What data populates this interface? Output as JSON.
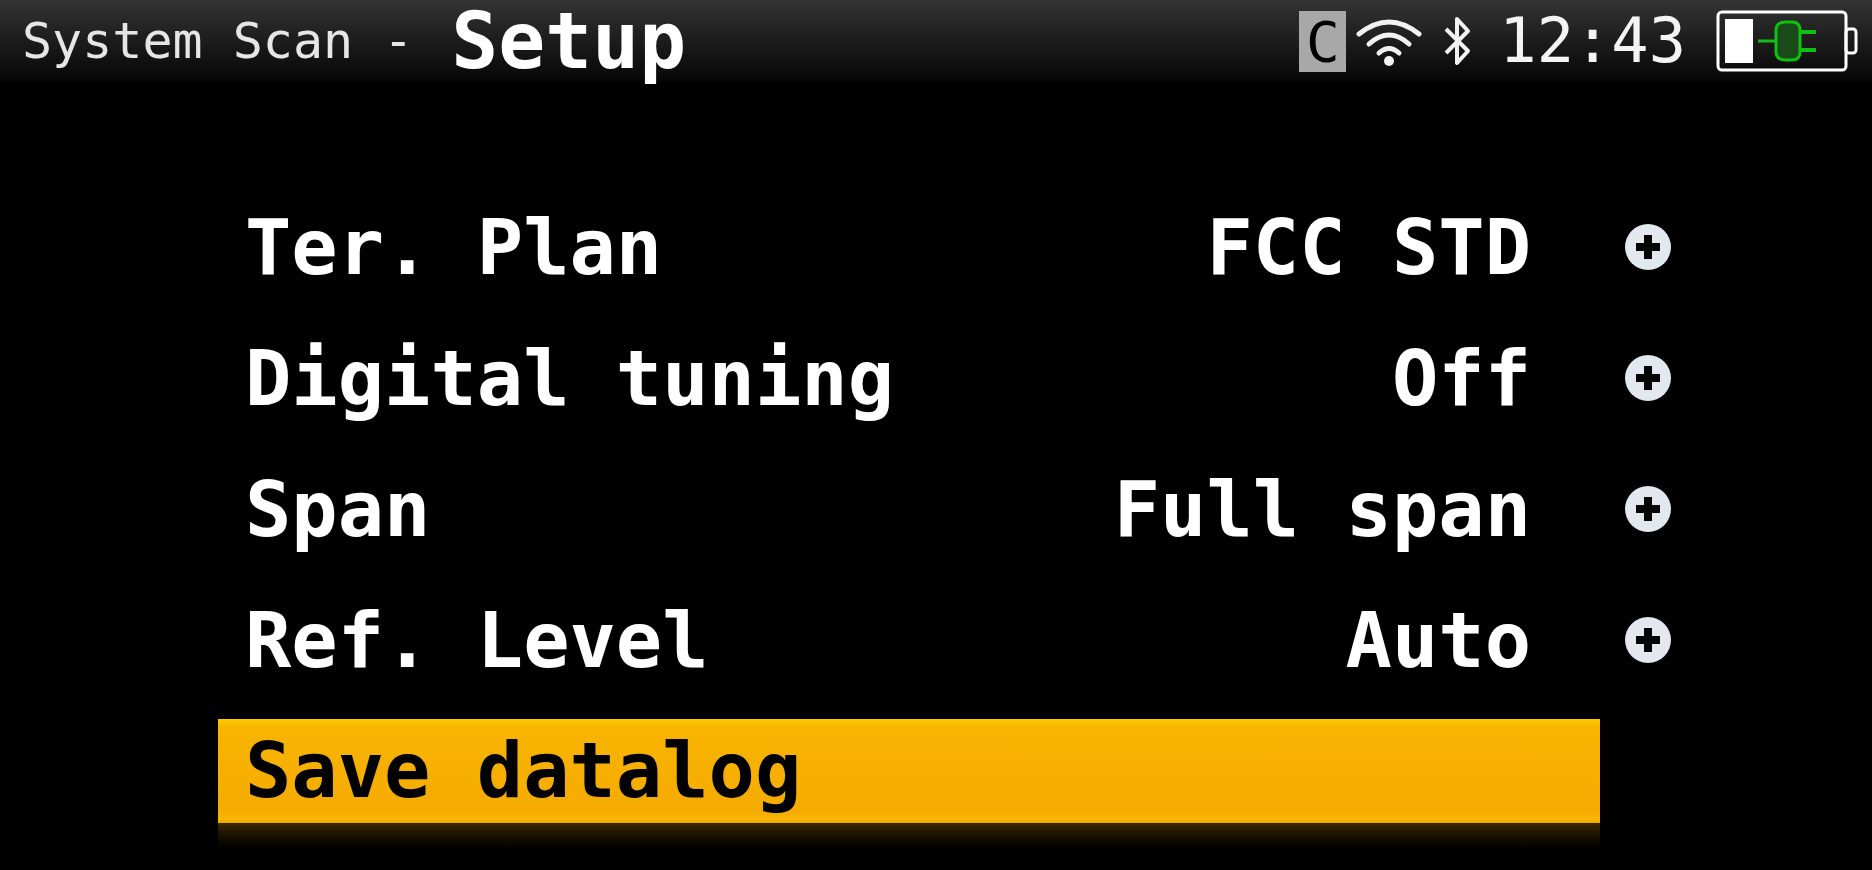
{
  "header": {
    "app_name": "System Scan -",
    "title": "Setup"
  },
  "status_bar": {
    "badge": "C",
    "time": "12:43"
  },
  "menu": {
    "items": [
      {
        "kind": "setting",
        "label": "Ter. Plan",
        "value": "FCC STD",
        "selected": false
      },
      {
        "kind": "setting",
        "label": "Digital tuning",
        "value": "Off",
        "selected": false
      },
      {
        "kind": "setting",
        "label": "Span",
        "value": "Full span",
        "selected": false
      },
      {
        "kind": "setting",
        "label": "Ref. Level",
        "value": "Auto",
        "selected": false
      },
      {
        "kind": "action",
        "label": "Save datalog",
        "selected": true
      }
    ]
  }
}
